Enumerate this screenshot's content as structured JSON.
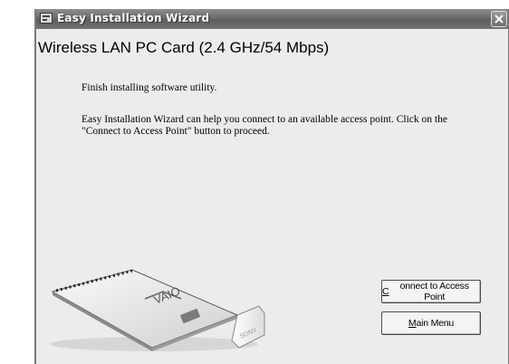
{
  "window": {
    "title": "Easy Installation Wizard",
    "close_glyph": "✕"
  },
  "main": {
    "heading": "Wireless LAN PC Card (2.4 GHz/54 Mbps)",
    "paragraph1": "Finish installing software utility.",
    "paragraph2": "Easy Installation Wizard can help you connect to an available access point. Click on the \"Connect to Access Point\" button to proceed."
  },
  "illustration": {
    "brand_logo": "VAIO",
    "maker_logo": "SONY"
  },
  "buttons": {
    "connect": {
      "mnemonic": "C",
      "rest": "onnect to Access Point"
    },
    "main_menu": {
      "mnemonic": "M",
      "rest": "ain Menu"
    }
  },
  "icons": [
    "app-icon",
    "close-icon",
    "pc-card-icon"
  ]
}
